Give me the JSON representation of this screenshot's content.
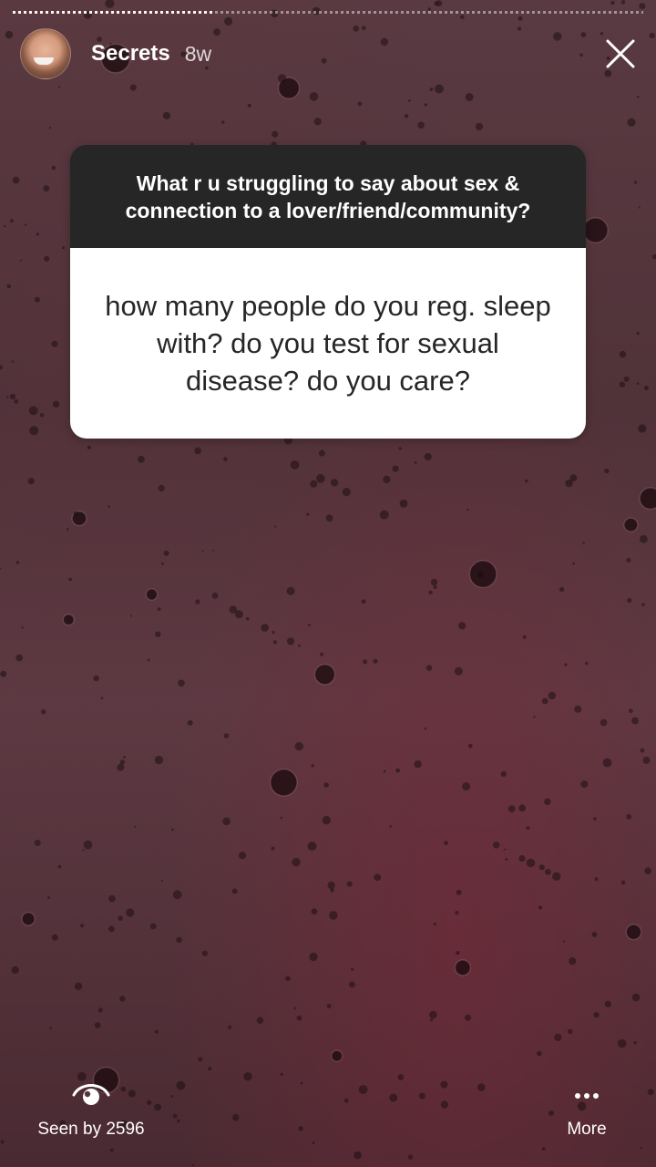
{
  "story": {
    "progress_fraction": 0.32,
    "user": {
      "username": "Secrets",
      "posted_ago": "8w"
    },
    "question_sticker": {
      "question": "What r u struggling to say about sex & connection to a lover/friend/community?",
      "answer": "how many people do you reg. sleep with? do you test for sexual disease? do you care?"
    },
    "footer": {
      "seen_by_label": "Seen by 2596",
      "more_label": "More"
    },
    "icons": {
      "close": "close-icon",
      "seen": "eye-icon",
      "more": "more-dots-icon"
    },
    "colors": {
      "card_header": "#262626",
      "card_body": "#ffffff",
      "background": "#56363e"
    }
  }
}
